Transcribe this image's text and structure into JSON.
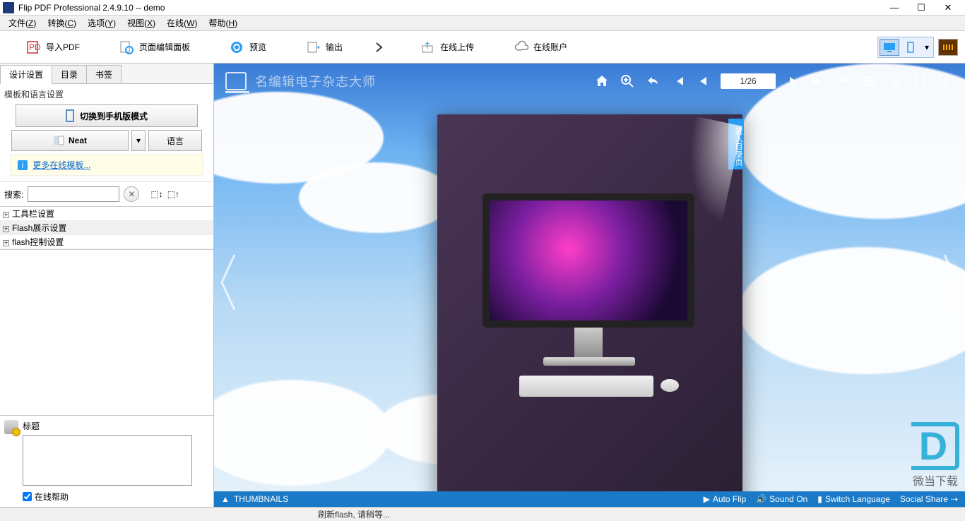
{
  "window": {
    "title": "Flip PDF Professional 2.4.9.10 -- demo"
  },
  "menu": [
    {
      "label": "文件",
      "key": "Z"
    },
    {
      "label": "转换",
      "key": "C"
    },
    {
      "label": "选项",
      "key": "Y"
    },
    {
      "label": "视图",
      "key": "X"
    },
    {
      "label": "在线",
      "key": "W"
    },
    {
      "label": "帮助",
      "key": "H"
    }
  ],
  "toolbar": {
    "import_pdf": "导入PDF",
    "page_editor": "页面编辑面板",
    "preview": "预览",
    "output": "输出",
    "upload": "在线上传",
    "account": "在线账户"
  },
  "sidebar": {
    "tabs": [
      "设计设置",
      "目录",
      "书签"
    ],
    "section_label": "模板和语言设置",
    "switch_mobile": "切换到手机版模式",
    "template_name": "Neat",
    "language_btn": "语言",
    "more_templates": "更多在线模板...",
    "search_label": "搜索:",
    "tree": [
      "工具栏设置",
      "Flash展示设置",
      "flash控制设置"
    ],
    "title_label": "标题",
    "help_checkbox": "在线帮助"
  },
  "preview": {
    "brand": "名编辑电子杂志大师",
    "page_indicator": "1/26",
    "toc_tab": "进入目录页",
    "fullscreen_label": "Click to view in fullscreen",
    "footer": {
      "thumbnails": "THUMBNAILS",
      "auto_flip": "Auto Flip",
      "sound": "Sound On",
      "language": "Switch Language",
      "share": "Social Share"
    }
  },
  "watermark": "微当下载",
  "statusbar": "刷新flash, 请稍等..."
}
